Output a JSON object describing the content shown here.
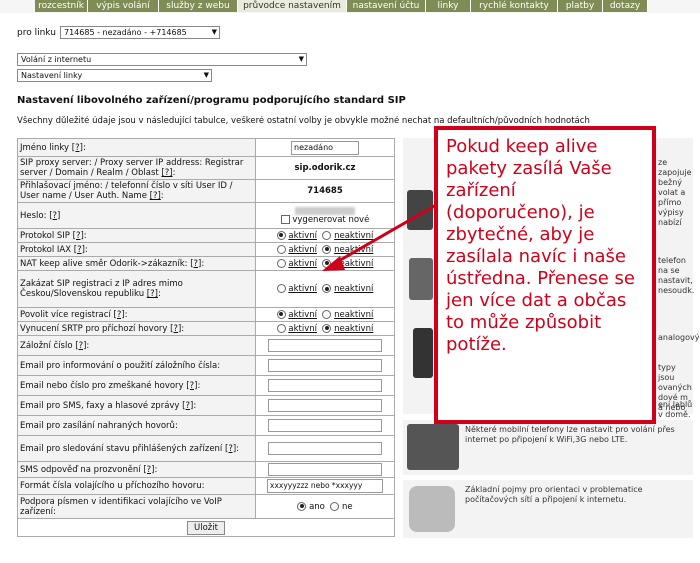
{
  "tabs": [
    "rozcestník",
    "výpis volání",
    "služby z webu",
    "průvodce nastavením",
    "nastavení účtu",
    "linky",
    "rychlé kontakty",
    "platby",
    "dotazy"
  ],
  "line_label": "pro linku",
  "line_select": "714685 - nezadáno - +714685",
  "select2": "Volání z internetu",
  "select3": "Nastavení linky",
  "heading": "Nastavení libovolného zařízení/programu podporujícího standard SIP",
  "intro": "Všechny důležité údaje jsou v následující tabulce, veškeré ostatní volby je obvykle možné nechat na defaultních/původních hodnotách",
  "help": "[?]",
  "rows": {
    "jmeno": "Jméno linky",
    "jmeno_val": "nezadáno",
    "proxy": "SIP proxy server: / Proxy server IP address: Registrar server / Domain / Realm / Oblast",
    "proxy_val": "sip.odorik.cz",
    "login": "Přihlašovací jméno: / telefonní číslo v síti User ID / User name / User Auth. Name",
    "login_val": "714685",
    "heslo": "Heslo:",
    "heslo_chk": "vygenerovat nové",
    "sip": "Protokol SIP",
    "iax": "Protokol IAX",
    "nat": "NAT keep alive směr Odorik->zákazník:",
    "zakazat": "Zakázat SIP registraci z IP adres mimo Českou/Slovenskou republiku",
    "vice": "Povolit více registrací",
    "srtp": "Vynucení SRTP pro příchozí hovory",
    "zalozni": "Záložní číslo",
    "email1": "Email pro informování o použití záložního čísla:",
    "email2": "Email nebo číslo pro zmeškané hovory",
    "email3": "Email pro SMS, faxy a hlasové zprávy",
    "email4": "Email pro zasílání nahraných hovorů:",
    "email5": "Email pro sledování stavu přihlášených zařízení",
    "sms": "SMS odpověď na prozvonění",
    "format": "Formát čísla volajícího u příchozího hovoru:",
    "format_val": "xxxyyyzzz nebo *xxxyyy",
    "pismena": "Podpora písmen v identifikaci volajícího ve VoIP zařízení:",
    "aktivni": "aktivní",
    "neaktivni": "neaktivní",
    "ano": "ano",
    "ne": "ne",
    "submit": "Uložit"
  },
  "side": {
    "t1": "ze zapojuje bežný volat a přímo výpisy nabízí",
    "t2": "telefon na se nastavit, nesoudk.",
    "t3": "analogových",
    "t4": "typy jsou ovaných dové m a nebo",
    "t5": "ení lablů v domě.",
    "mobile": "Některé mobilní telefony lze nastavit pro volání přes internet po připojení k WiFi,3G nebo LTE.",
    "mobile_link": "mobilní telefony",
    "basics": "Základní pojmy pro orientaci v problematice počítačových sítí a připojení k internetu.",
    "basics_link": "Základní pojmy"
  },
  "overlay": "Pokud keep alive pakety zasílá Vaše zařízení (doporučeno), je zbytečné, aby je zasílala navíc i naše ústředna. Přenese se jen více dat a občas to může způsobit potíže."
}
